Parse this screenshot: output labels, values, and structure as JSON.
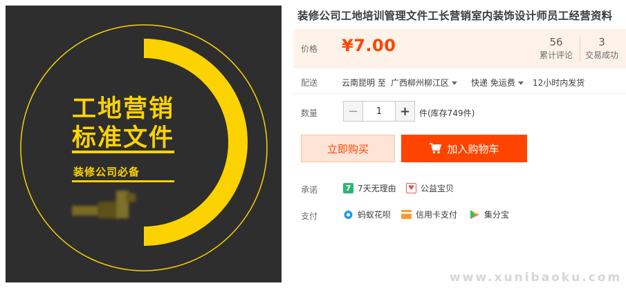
{
  "product_image": {
    "title_line1": "工地营销",
    "title_line2": "标准文件",
    "subtitle": "装修公司必备",
    "accent": "#fcd300",
    "background": "#2e2e2e"
  },
  "product": {
    "title": "装修公司工地培训管理文件工长营销室内装饰设计师员工经营资料"
  },
  "price": {
    "label": "价格",
    "value": "¥7.00",
    "color": "#ff4400"
  },
  "stats": [
    {
      "num": "56",
      "label": "累计评论"
    },
    {
      "num": "3",
      "label": "交易成功"
    }
  ],
  "shipping": {
    "label": "配送",
    "from": "云南昆明 至",
    "to": "广西柳州柳江区",
    "method": "快递 免运费",
    "dispatch": "12小时内发货"
  },
  "quantity": {
    "label": "数量",
    "minus": "−",
    "value": "1",
    "plus": "+",
    "stock": "件(库存749件)"
  },
  "buttons": {
    "buy_now": "立即购买",
    "add_to_cart": "加入购物车"
  },
  "promise": {
    "label": "承诺",
    "items": [
      {
        "icon": "seven-days-icon",
        "glyph": "7",
        "text": "7天无理由"
      },
      {
        "icon": "charity-heart-icon",
        "glyph": "♥",
        "text": "公益宝贝"
      }
    ]
  },
  "payment": {
    "label": "支付",
    "items": [
      {
        "icon": "huabei-icon",
        "text": "蚂蚁花呗"
      },
      {
        "icon": "credit-card-icon",
        "text": "信用卡支付"
      },
      {
        "icon": "jifenbao-icon",
        "text": "集分宝"
      }
    ]
  },
  "watermark": "www.xunibaoku.com"
}
